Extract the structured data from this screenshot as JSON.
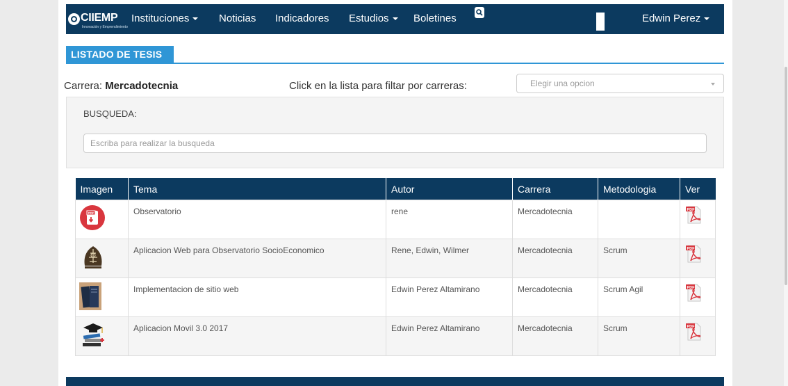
{
  "navbar": {
    "brand": "CIIEMP",
    "brand_sub": "Innovación y Emprendimiento",
    "items": [
      {
        "label": "Instituciones",
        "dropdown": true
      },
      {
        "label": "Noticias",
        "dropdown": false
      },
      {
        "label": "Indicadores",
        "dropdown": false
      },
      {
        "label": "Estudios",
        "dropdown": true
      },
      {
        "label": "Boletines",
        "dropdown": false
      }
    ],
    "search_icon": "search-icon",
    "user": "Edwin Perez"
  },
  "page": {
    "title": "LISTADO DE TESIS",
    "carrera_label": "Carrera:",
    "carrera_value": "Mercadotecnia",
    "filter_hint": "Click en la lista para filtar por carreras:",
    "select_placeholder": "Elegir una opcion"
  },
  "search": {
    "label": "BUSQUEDA:",
    "placeholder": "Escriba para realizar la busqueda",
    "value": ""
  },
  "table": {
    "columns": [
      "Imagen",
      "Tema",
      "Autor",
      "Carrera",
      "Metodologia",
      "Ver"
    ],
    "rows": [
      {
        "image": "pdf-badge-icon",
        "tema": "Observatorio",
        "autor": "rene",
        "carrera": "Mercadotecnia",
        "metodologia": "",
        "ver": "pdf-file-icon"
      },
      {
        "image": "observatorio-logo-icon",
        "tema": "Aplicacion Web para Observatorio SocioEconomico",
        "autor": "Rene, Edwin, Wilmer",
        "carrera": "Mercadotecnia",
        "metodologia": "Scrum",
        "ver": "pdf-file-icon"
      },
      {
        "image": "books-icon",
        "tema": "Implementacion de sitio web",
        "autor": "Edwin Perez Altamirano",
        "carrera": "Mercadotecnia",
        "metodologia": "Scrum Agil",
        "ver": "pdf-file-icon"
      },
      {
        "image": "graduation-books-icon",
        "tema": "Aplicacion Movil 3.0 2017",
        "autor": "Edwin Perez Altamirano",
        "carrera": "Mercadotecnia",
        "metodologia": "Scrum",
        "ver": "pdf-file-icon"
      }
    ]
  },
  "colors": {
    "navy": "#0c3a5f",
    "accent_blue": "#2f96d6",
    "pdf_red": "#d9363e"
  }
}
